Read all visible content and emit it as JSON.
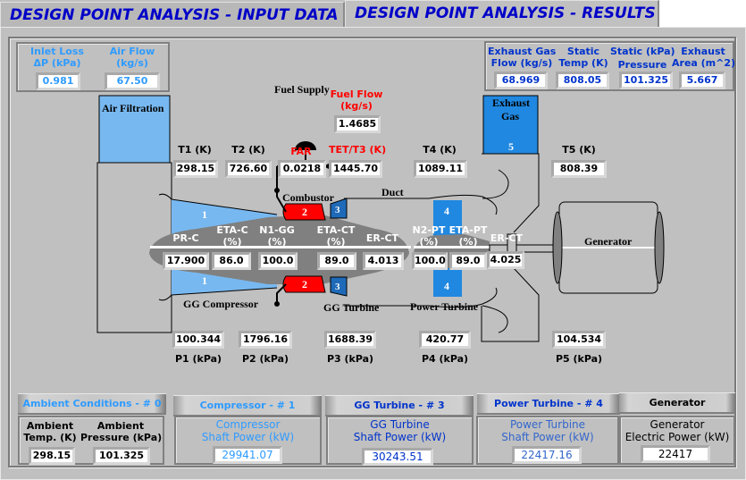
{
  "tabs": [
    {
      "label": "DESIGN POINT ANALYSIS - INPUT DATA",
      "active": false
    },
    {
      "label": "DESIGN POINT ANALYSIS - RESULTS",
      "active": true
    }
  ],
  "inputs": {
    "inlet_loss_label_1": "Inlet Loss",
    "inlet_loss_label_2": "ΔP (kPa)",
    "inlet_loss_value": "0.981",
    "air_flow_label_1": "Air Flow",
    "air_flow_label_2": "(kg/s)",
    "air_flow_value": "67.50"
  },
  "exhaust": {
    "flow_label_1": "Exhaust Gas",
    "flow_label_2": "Flow (kg/s)",
    "flow_value": "68.969",
    "temp_label_1": "Static",
    "temp_label_2": "Temp (K)",
    "temp_value": "808.05",
    "pressure_label_1": "Static (kPa)",
    "pressure_label_2": "Pressure",
    "pressure_value": "101.325",
    "area_label_1": "Exhaust",
    "area_label_2": "Area (m^2)",
    "area_value": "5.667"
  },
  "diagram": {
    "air_filtration": "Air Filtration",
    "fuel_supply": "Fuel Supply",
    "fuel_flow_label_1": "Fuel Flow",
    "fuel_flow_label_2": "(kg/s)",
    "fuel_flow_value": "1.4685",
    "combustor": "Combustor",
    "duct": "Duct",
    "exhaust_gas_1": "Exhaust",
    "exhaust_gas_2": "Gas",
    "gg_compressor": "GG Compressor",
    "gg_turbine": "GG Turbine",
    "power_turbine": "Power Turbine",
    "generator": "Generator",
    "station_1": "1",
    "station_2": "2",
    "station_3": "3",
    "station_4": "4",
    "station_5": "5"
  },
  "temperatures": {
    "t1_label": "T1 (K)",
    "t1_value": "298.15",
    "t2_label": "T2 (K)",
    "t2_value": "726.60",
    "far_label": "FAR",
    "far_value": "0.0218",
    "tet_label": "TET/T3 (K)",
    "tet_value": "1445.70",
    "t4_label": "T4 (K)",
    "t4_value": "1089.11",
    "t5_label": "T5 (K)",
    "t5_value": "808.39"
  },
  "shaft": {
    "prc_label": "PR-C",
    "prc_value": "17.900",
    "etac_label_1": "ETA-C",
    "etac_label_2": "(%)",
    "etac_value": "86.0",
    "n1_label_1": "N1-GG",
    "n1_label_2": "(%)",
    "n1_value": "100.0",
    "etact_label_1": "ETA-CT",
    "etact_label_2": "(%)",
    "etact_value": "89.0",
    "erct_label": "ER-CT",
    "erct_value": "4.013",
    "n2_label_1": "N2-PT",
    "n2_label_2": "(%)",
    "n2_value": "100.0",
    "etapt_label_1": "ETA-PT",
    "etapt_label_2": "(%)",
    "etapt_value": "89.0",
    "erpt_label": "ER-CT",
    "erpt_value": "4.025"
  },
  "pressures": {
    "p1_label": "P1 (kPa)",
    "p1_value": "100.344",
    "p2_label": "P2 (kPa)",
    "p2_value": "1796.16",
    "p3_label": "P3 (kPa)",
    "p3_value": "1688.39",
    "p4_label": "P4 (kPa)",
    "p4_value": "420.77",
    "p5_label": "P5 (kPa)",
    "p5_value": "104.534"
  },
  "bottom": {
    "ambient_button": "Ambient Conditions - # 0",
    "ambient_temp_label_1": "Ambient",
    "ambient_temp_label_2": "Temp. (K)",
    "ambient_temp_value": "298.15",
    "ambient_pressure_label_1": "Ambient",
    "ambient_pressure_label_2": "Pressure (kPa)",
    "ambient_pressure_value": "101.325",
    "compressor_button": "Compressor - # 1",
    "compressor_label_1": "Compressor",
    "compressor_label_2": "Shaft Power (kW)",
    "compressor_value": "29941.07",
    "ggturbine_button": "GG Turbine - # 3",
    "ggturbine_label_1": "GG Turbine",
    "ggturbine_label_2": "Shaft Power (kW)",
    "ggturbine_value": "30243.51",
    "powerturbine_button": "Power Turbine - # 4",
    "powerturbine_label_1": "Power Turbine",
    "powerturbine_label_2": "Shaft Power (kW)",
    "powerturbine_value": "22417.16",
    "generator_button": "Generator",
    "generator_label_1": "Generator",
    "generator_label_2": "Electric Power (kW)",
    "generator_value": "22417"
  },
  "colors": {
    "title_blue": "#0000c8",
    "light_blue": "#2e9bff",
    "dark_blue": "#0033cc",
    "red": "#ff0000",
    "compressor_fill": "#78b8f0",
    "turbine_fill": "#2088e0",
    "combustor_fill": "#ff0000",
    "background": "#c0c0c0"
  }
}
